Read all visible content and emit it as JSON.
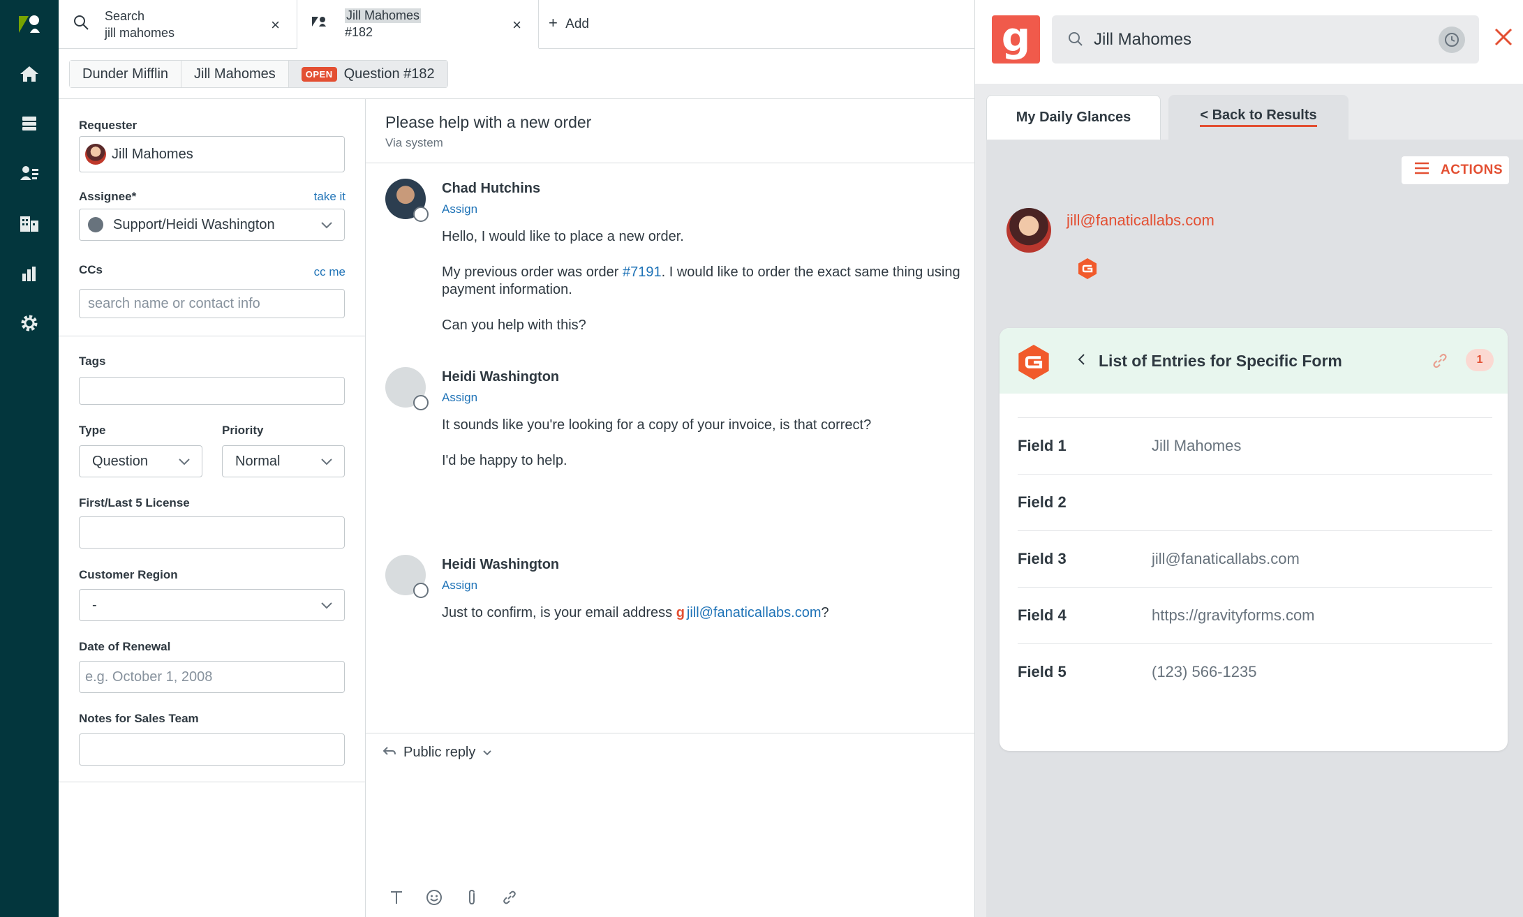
{
  "colors": {
    "nav_bg": "#03363d",
    "accent": "#e34f32",
    "link": "#1f73b7",
    "app_logo_bg": "#f05a4b",
    "card_header_bg": "#e8f6ee"
  },
  "nav": {
    "icons": [
      "zendesk-logo-icon",
      "home-icon",
      "views-icon",
      "customers-icon",
      "organizations-icon",
      "reporting-icon",
      "settings-icon"
    ]
  },
  "tabs": [
    {
      "title": "Search",
      "subtitle": "jill mahomes"
    },
    {
      "title": "Jill Mahomes",
      "subtitle": "#182"
    }
  ],
  "add_tab_label": "Add",
  "breadcrumb": {
    "org": "Dunder Mifflin",
    "user": "Jill Mahomes",
    "status": "OPEN",
    "ticket": "Question #182"
  },
  "properties": {
    "requester_label": "Requester",
    "requester_value": "Jill Mahomes",
    "assignee_label": "Assignee*",
    "take_it": "take it",
    "assignee_value": "Support/Heidi Washington",
    "ccs_label": "CCs",
    "cc_me": "cc me",
    "ccs_placeholder": "search name or contact info",
    "tags_label": "Tags",
    "type_label": "Type",
    "type_value": "Question",
    "priority_label": "Priority",
    "priority_value": "Normal",
    "license_label": "First/Last 5 License",
    "region_label": "Customer Region",
    "region_value": "-",
    "renewal_label": "Date of Renewal",
    "renewal_placeholder": "e.g. October 1, 2008",
    "notes_label": "Notes for Sales Team"
  },
  "conversation": {
    "subject": "Please help with a new order",
    "via": "Via system",
    "messages": [
      {
        "author": "Chad Hutchins",
        "assign": "Assign",
        "line1": "Hello, I would like to place a new order.",
        "line2a": "My previous order was order ",
        "line2link": "#7191",
        "line2b": ". I would like to order the exact same thing using",
        "line3": "payment information.",
        "line4": "Can you help with this?"
      },
      {
        "author": "Heidi Washington",
        "assign": "Assign",
        "line1": "It sounds like you're looking for a copy of your invoice, is that correct?",
        "line2": "I'd be happy to help."
      },
      {
        "author": "Heidi Washington",
        "assign": "Assign",
        "text": "Just to confirm, is your email address ",
        "email": "jill@fanaticallabs.com",
        "suffix": "?"
      }
    ],
    "reply_label": "Public reply",
    "toolbar_icons": [
      "text-format-icon",
      "emoji-icon",
      "attachment-icon",
      "link-icon"
    ]
  },
  "app": {
    "logo": "g",
    "search_value": "Jill Mahomes",
    "tab_glances": "My Daily Glances",
    "tab_back": "< Back to Results",
    "actions_label": "ACTIONS",
    "contact_email": "jill@fanaticallabs.com",
    "card": {
      "title": "List of Entries for Specific Form",
      "count": "1",
      "fields": [
        {
          "key": "Field 1",
          "value": "Jill Mahomes"
        },
        {
          "key": "Field 2",
          "value": ""
        },
        {
          "key": "Field 3",
          "value": "jill@fanaticallabs.com"
        },
        {
          "key": "Field 4",
          "value": "https://gravityforms.com"
        },
        {
          "key": "Field 5",
          "value": "(123) 566-1235"
        }
      ]
    }
  }
}
